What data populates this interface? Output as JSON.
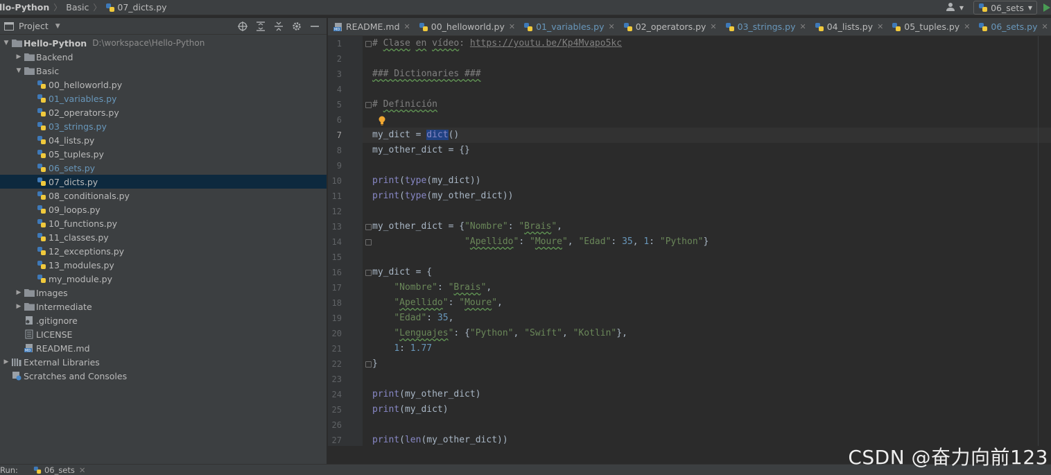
{
  "navbar": {
    "project": "llo-Python",
    "folder": "Basic",
    "file": "07_dicts.py",
    "run_config": "06_sets"
  },
  "project_panel": {
    "title": "Project",
    "tools": [
      "target-icon",
      "expand-all-icon",
      "collapse-all-icon",
      "gear-icon",
      "minimize-icon"
    ],
    "tree": [
      {
        "label": "Hello-Python",
        "path": "D:\\workspace\\Hello-Python",
        "kind": "root",
        "depth": 0,
        "expanded": true
      },
      {
        "label": "Backend",
        "kind": "folder",
        "depth": 1,
        "expanded": false
      },
      {
        "label": "Basic",
        "kind": "folder",
        "depth": 1,
        "expanded": true
      },
      {
        "label": "00_helloworld.py",
        "kind": "py",
        "depth": 2
      },
      {
        "label": "01_variables.py",
        "kind": "py",
        "depth": 2,
        "vcs": true
      },
      {
        "label": "02_operators.py",
        "kind": "py",
        "depth": 2
      },
      {
        "label": "03_strings.py",
        "kind": "py",
        "depth": 2,
        "vcs": true
      },
      {
        "label": "04_lists.py",
        "kind": "py",
        "depth": 2
      },
      {
        "label": "05_tuples.py",
        "kind": "py",
        "depth": 2
      },
      {
        "label": "06_sets.py",
        "kind": "py",
        "depth": 2,
        "vcs": true
      },
      {
        "label": "07_dicts.py",
        "kind": "py",
        "depth": 2,
        "selected": true
      },
      {
        "label": "08_conditionals.py",
        "kind": "py",
        "depth": 2
      },
      {
        "label": "09_loops.py",
        "kind": "py",
        "depth": 2
      },
      {
        "label": "10_functions.py",
        "kind": "py",
        "depth": 2
      },
      {
        "label": "11_classes.py",
        "kind": "py",
        "depth": 2
      },
      {
        "label": "12_exceptions.py",
        "kind": "py",
        "depth": 2
      },
      {
        "label": "13_modules.py",
        "kind": "py",
        "depth": 2
      },
      {
        "label": "my_module.py",
        "kind": "py",
        "depth": 2
      },
      {
        "label": "Images",
        "kind": "folder",
        "depth": 1,
        "expanded": false
      },
      {
        "label": "Intermediate",
        "kind": "folder",
        "depth": 1,
        "expanded": false
      },
      {
        "label": ".gitignore",
        "kind": "gitignore",
        "depth": 1
      },
      {
        "label": "LICENSE",
        "kind": "text",
        "depth": 1
      },
      {
        "label": "README.md",
        "kind": "md",
        "depth": 1
      },
      {
        "label": "External Libraries",
        "kind": "libs",
        "depth": 0,
        "expanded": false
      },
      {
        "label": "Scratches and Consoles",
        "kind": "scratch",
        "depth": 0
      }
    ]
  },
  "tabs": [
    {
      "label": "README.md",
      "kind": "md"
    },
    {
      "label": "00_helloworld.py",
      "kind": "py"
    },
    {
      "label": "01_variables.py",
      "kind": "py",
      "vcs": true
    },
    {
      "label": "02_operators.py",
      "kind": "py"
    },
    {
      "label": "03_strings.py",
      "kind": "py",
      "vcs": true
    },
    {
      "label": "04_lists.py",
      "kind": "py"
    },
    {
      "label": "05_tuples.py",
      "kind": "py"
    },
    {
      "label": "06_sets.py",
      "kind": "py",
      "vcs": true
    }
  ],
  "editor": {
    "current_line": 7,
    "lines": [
      [
        [
          "cm",
          "# "
        ],
        [
          "cm typo",
          "Clase"
        ],
        [
          "cm",
          " "
        ],
        [
          "cm typo",
          "en"
        ],
        [
          "cm",
          " "
        ],
        [
          "cm typo",
          "vídeo"
        ],
        [
          "cm",
          ": "
        ],
        [
          "url",
          "https://youtu.be/Kp4Mvapo5kc"
        ]
      ],
      [],
      [
        [
          "cm typo",
          "### Dictionaries ###"
        ]
      ],
      [],
      [
        [
          "cm",
          "# "
        ],
        [
          "cm typo",
          "Definición"
        ]
      ],
      [],
      [
        [
          "",
          "my_dict = "
        ],
        [
          "bi sel-word",
          "dict"
        ],
        [
          "",
          "()"
        ]
      ],
      [
        [
          "",
          "my_other_dict = {}"
        ]
      ],
      [],
      [
        [
          "bi",
          "print"
        ],
        [
          "",
          "("
        ],
        [
          "bi",
          "type"
        ],
        [
          "",
          "(my_dict))"
        ]
      ],
      [
        [
          "bi",
          "print"
        ],
        [
          "",
          "("
        ],
        [
          "bi",
          "type"
        ],
        [
          "",
          "(my_other_dict))"
        ]
      ],
      [],
      [
        [
          "",
          "my_other_dict = {"
        ],
        [
          "str",
          "\"Nombre\""
        ],
        [
          "",
          ": "
        ],
        [
          "str",
          "\""
        ],
        [
          "str typo",
          "Brais"
        ],
        [
          "str",
          "\""
        ],
        [
          "",
          ","
        ]
      ],
      [
        [
          "",
          "                 "
        ],
        [
          "str",
          "\""
        ],
        [
          "str typo",
          "Apellido"
        ],
        [
          "str",
          "\""
        ],
        [
          "",
          ": "
        ],
        [
          "str",
          "\""
        ],
        [
          "str typo",
          "Moure"
        ],
        [
          "str",
          "\""
        ],
        [
          "",
          ", "
        ],
        [
          "str",
          "\"Edad\""
        ],
        [
          "",
          ": "
        ],
        [
          "num",
          "35"
        ],
        [
          "",
          ", "
        ],
        [
          "num",
          "1"
        ],
        [
          "",
          ": "
        ],
        [
          "str",
          "\"Python\""
        ],
        [
          "",
          "}"
        ]
      ],
      [],
      [
        [
          "",
          "my_dict = {"
        ]
      ],
      [
        [
          "",
          "    "
        ],
        [
          "str",
          "\"Nombre\""
        ],
        [
          "",
          ": "
        ],
        [
          "str",
          "\""
        ],
        [
          "str typo",
          "Brais"
        ],
        [
          "str",
          "\""
        ],
        [
          "",
          ","
        ]
      ],
      [
        [
          "",
          "    "
        ],
        [
          "str",
          "\""
        ],
        [
          "str typo",
          "Apellido"
        ],
        [
          "str",
          "\""
        ],
        [
          "",
          ": "
        ],
        [
          "str",
          "\""
        ],
        [
          "str typo",
          "Moure"
        ],
        [
          "str",
          "\""
        ],
        [
          "",
          ","
        ]
      ],
      [
        [
          "",
          "    "
        ],
        [
          "str",
          "\"Edad\""
        ],
        [
          "",
          ": "
        ],
        [
          "num",
          "35"
        ],
        [
          "",
          ","
        ]
      ],
      [
        [
          "",
          "    "
        ],
        [
          "str",
          "\""
        ],
        [
          "str typo",
          "Lenguajes"
        ],
        [
          "str",
          "\""
        ],
        [
          "",
          ": {"
        ],
        [
          "str",
          "\"Python\""
        ],
        [
          "",
          ", "
        ],
        [
          "str",
          "\"Swift\""
        ],
        [
          "",
          ", "
        ],
        [
          "str",
          "\"Kotlin\""
        ],
        [
          "",
          "},"
        ]
      ],
      [
        [
          "",
          "    "
        ],
        [
          "num",
          "1"
        ],
        [
          "",
          ": "
        ],
        [
          "num",
          "1.77"
        ]
      ],
      [
        [
          "",
          "}"
        ]
      ],
      [],
      [
        [
          "bi",
          "print"
        ],
        [
          "",
          "(my_other_dict)"
        ]
      ],
      [
        [
          "bi",
          "print"
        ],
        [
          "",
          "(my_dict)"
        ]
      ],
      [],
      [
        [
          "bi",
          "print"
        ],
        [
          "",
          "("
        ],
        [
          "bi",
          "len"
        ],
        [
          "",
          "(my_other_dict))"
        ]
      ]
    ],
    "fold_lines": [
      1,
      5,
      13,
      14,
      16,
      22
    ]
  },
  "statusbar": {
    "run_label": "Run:",
    "run_tab": "06_sets"
  },
  "watermark": "CSDN @奋力向前123",
  "colors": {
    "background": "#2b2b2b",
    "panel": "#3c3f41",
    "selection": "#0d293e",
    "vcs_modified": "#6897bb",
    "string": "#6a8759",
    "number": "#6897bb",
    "comment": "#808080",
    "builtin": "#8888c6"
  }
}
